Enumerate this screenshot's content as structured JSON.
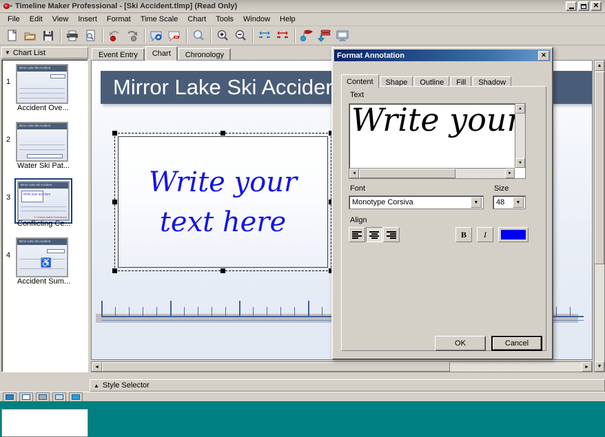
{
  "window": {
    "title": "Timeline Maker Professional - [Ski Accident.tlmp] (Read Only)",
    "app_icon": "timeline-icon",
    "minimize_label": "_",
    "maximize_label": "□",
    "close_label": "✕"
  },
  "menu": {
    "items": [
      {
        "label": "File"
      },
      {
        "label": "Edit"
      },
      {
        "label": "View"
      },
      {
        "label": "Insert"
      },
      {
        "label": "Format"
      },
      {
        "label": "Time Scale"
      },
      {
        "label": "Chart"
      },
      {
        "label": "Tools"
      },
      {
        "label": "Window"
      },
      {
        "label": "Help"
      }
    ]
  },
  "toolbar": {
    "buttons": [
      {
        "name": "new-icon"
      },
      {
        "name": "open-icon"
      },
      {
        "name": "save-icon"
      },
      {
        "sep": true
      },
      {
        "name": "print-icon"
      },
      {
        "name": "print-preview-icon"
      },
      {
        "sep": true
      },
      {
        "name": "undo-icon"
      },
      {
        "name": "redo-icon"
      },
      {
        "sep": true
      },
      {
        "name": "add-event-icon"
      },
      {
        "name": "delete-event-icon"
      },
      {
        "sep": true
      },
      {
        "name": "zoom-icon"
      },
      {
        "sep": true
      },
      {
        "name": "zoom-in-icon"
      },
      {
        "name": "zoom-out-icon"
      },
      {
        "sep": true
      },
      {
        "name": "expand-horizontal-icon"
      },
      {
        "name": "compress-horizontal-icon"
      },
      {
        "sep": true
      },
      {
        "name": "flag-marker-icon"
      },
      {
        "name": "stack-bars-icon"
      },
      {
        "name": "display-icon"
      }
    ]
  },
  "sidebar": {
    "header": "Chart List",
    "header_caret": "▼",
    "items": [
      {
        "number": "1",
        "label": "Accident Ove...",
        "thumb_title": "Mirror Lake Ski Accident",
        "selected": false
      },
      {
        "number": "2",
        "label": "Water Ski Pat...",
        "thumb_title": "Mirror Lake Ski Accident",
        "selected": false
      },
      {
        "number": "3",
        "label": "Conflicting Ce...",
        "thumb_title": "Mirror Lake Ski Accident",
        "selected": true,
        "thumb_text": "Write your text here",
        "thumb_footnote": "© Timeline Maker Professional"
      },
      {
        "number": "4",
        "label": "Accident Sum...",
        "thumb_title": "Mirror Lake Ski Accident",
        "selected": false
      }
    ]
  },
  "main": {
    "tabs": [
      {
        "label": "Event Entry",
        "active": false
      },
      {
        "label": "Chart",
        "active": true
      },
      {
        "label": "Chronology",
        "active": false
      }
    ],
    "chart_title": "Mirror Lake Ski Accident",
    "annotation": {
      "line1": "Write your",
      "line2": "text here",
      "color": "#1515e0",
      "selected": true
    },
    "scroll": {
      "left_arrow": "◄",
      "right_arrow": "►",
      "up_arrow": "▲",
      "down_arrow": "▼"
    }
  },
  "status": {
    "style_selector": "Style Selector",
    "style_selector_caret": "▲"
  },
  "dialog": {
    "title": "Format Annotation",
    "close_label": "✕",
    "tabs": [
      {
        "label": "Content",
        "active": true
      },
      {
        "label": "Shape",
        "active": false
      },
      {
        "label": "Outline",
        "active": false
      },
      {
        "label": "Fill",
        "active": false
      },
      {
        "label": "Shadow",
        "active": false
      }
    ],
    "text_label": "Text",
    "text_value": "Write your",
    "font_label": "Font",
    "font_value": "Monotype Corsiva",
    "size_label": "Size",
    "size_value": "48",
    "align_label": "Align",
    "align_options": [
      {
        "name": "align-left-button",
        "selected": false
      },
      {
        "name": "align-center-button",
        "selected": true
      },
      {
        "name": "align-right-button",
        "selected": false
      }
    ],
    "bold_label": "B",
    "italic_label": "I",
    "color_swatch": "#0000ee",
    "ok_label": "OK",
    "cancel_label": "Cancel",
    "dropdown_arrow": "▼"
  }
}
